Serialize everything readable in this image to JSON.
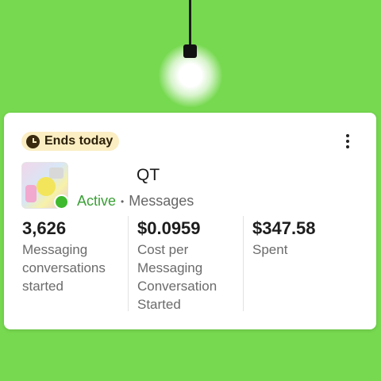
{
  "badge": {
    "icon": "clock-icon",
    "text": "Ends today"
  },
  "ad": {
    "name": "QT",
    "status": "Active",
    "objective": "Messages",
    "status_color": "#3fb92e"
  },
  "metrics": [
    {
      "value": "3,626",
      "label": "Messaging conversations started"
    },
    {
      "value": "$0.0959",
      "label": "Cost per Messaging Conversation Started"
    },
    {
      "value": "$347.58",
      "label": "Spent"
    }
  ],
  "menu": {
    "icon": "more-vertical-icon"
  },
  "colors": {
    "background": "#77d950",
    "badge": "#fbeec3",
    "accent": "#3aa035"
  }
}
